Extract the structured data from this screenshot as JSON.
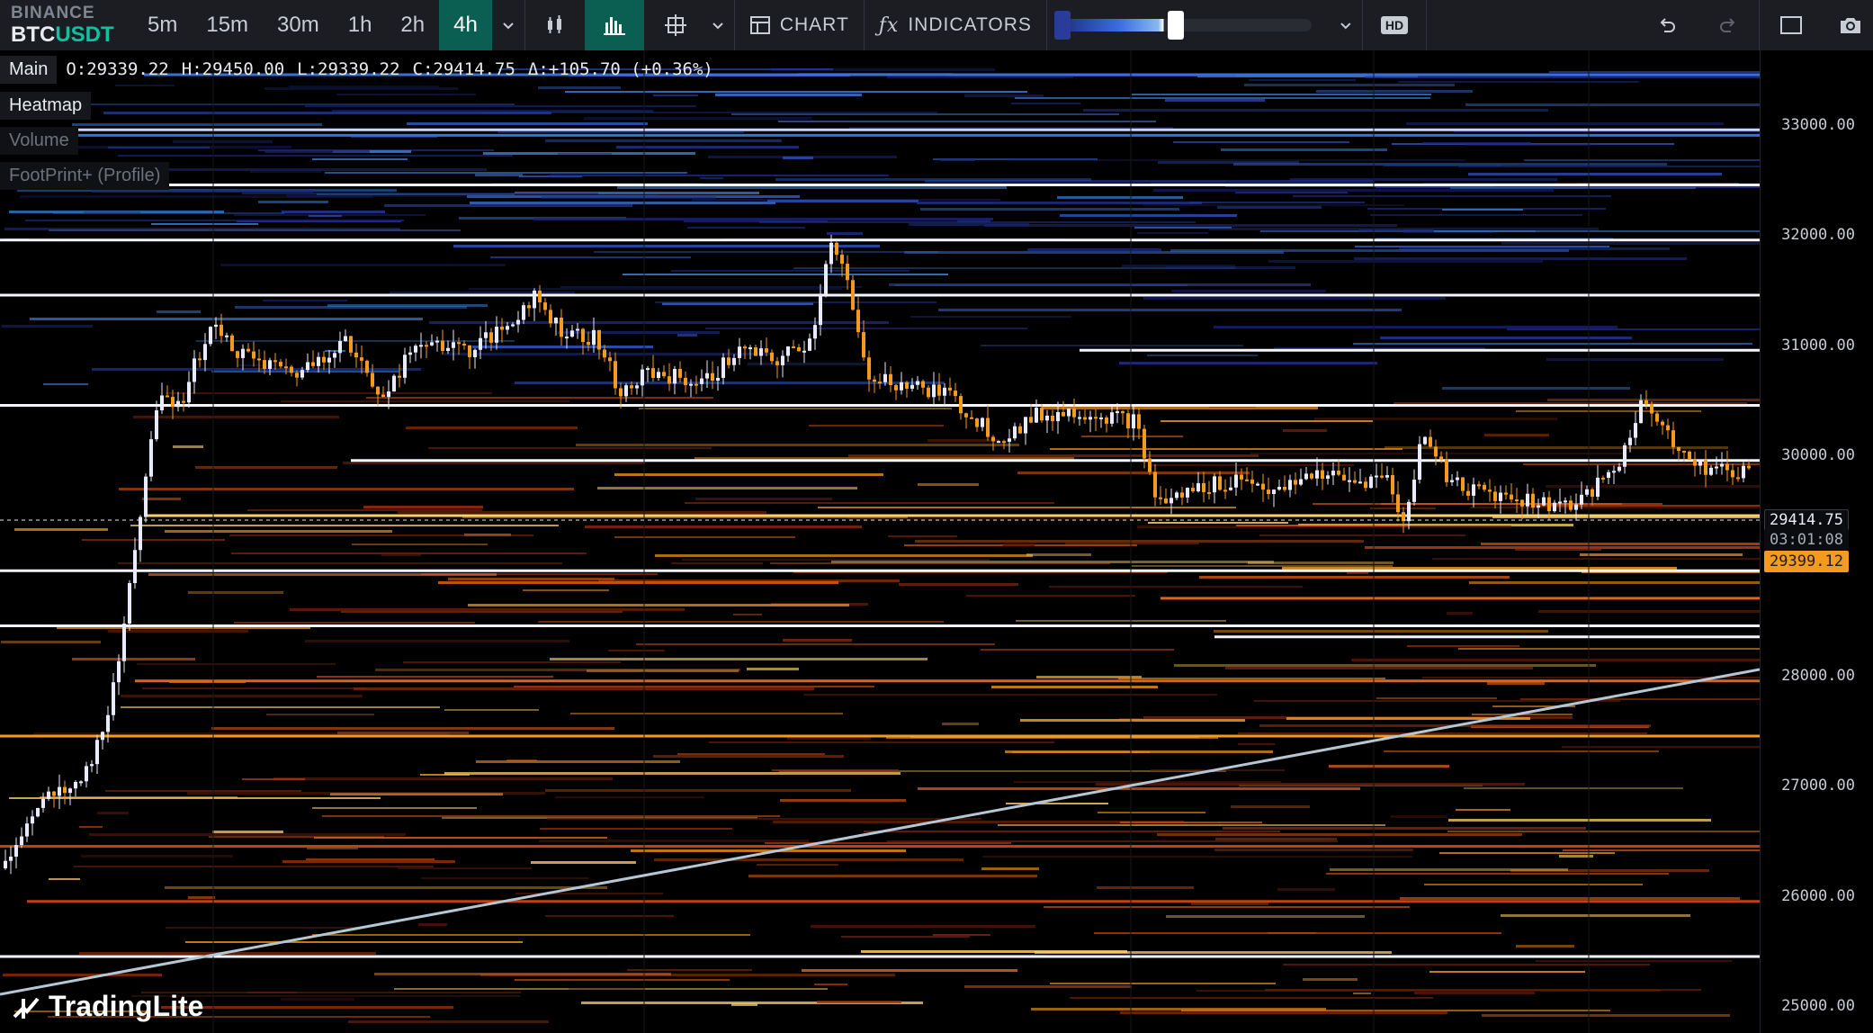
{
  "symbol": {
    "exchange": "BINANCE",
    "base": "BTC",
    "quote": "USDT"
  },
  "timeframes": [
    "5m",
    "15m",
    "30m",
    "1h",
    "2h",
    "4h"
  ],
  "active_timeframe": "4h",
  "toolbar": {
    "chart_label": "CHART",
    "indicators_label": "INDICATORS",
    "hd_label": "HD"
  },
  "legend": {
    "main_label": "Main",
    "open": "O:29339.22",
    "high": "H:29450.00",
    "low": "L:29339.22",
    "close": "C:29414.75",
    "delta": "Δ:+105.70 (+0.36%)"
  },
  "layers": [
    {
      "label": "Heatmap",
      "state": "active"
    },
    {
      "label": "Volume",
      "state": "hidden"
    },
    {
      "label": "FootPrint+ (Profile)",
      "state": "hidden"
    }
  ],
  "price_axis": {
    "ticks": [
      "33000.00",
      "32000.00",
      "31000.00",
      "30000.00",
      "28000.00",
      "27000.00",
      "26000.00",
      "25000.00"
    ],
    "current_price": "29414.75",
    "countdown": "03:01:08",
    "marker_price": "29399.12"
  },
  "colors": {
    "accent": "#0fc1a1",
    "active_bg": "#0b5f52",
    "candle_up": "#e8eaff",
    "candle_down": "#f39a1f",
    "marker": "#f39a1f"
  },
  "branding": {
    "logo_text": "TradingLite"
  }
}
